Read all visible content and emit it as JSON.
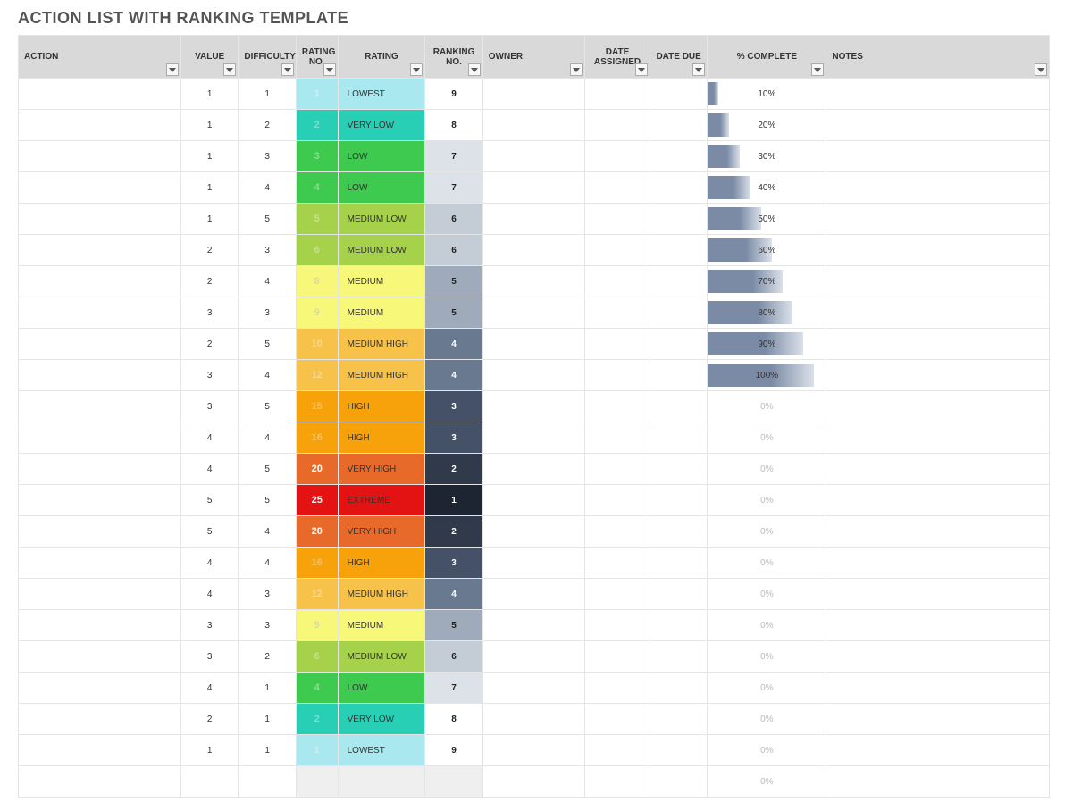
{
  "page": {
    "title": "ACTION LIST WITH RANKING TEMPLATE"
  },
  "headers": {
    "action": "ACTION",
    "value": "VALUE",
    "difficulty": "DIFFICULTY",
    "rating_no": "RATING NO.",
    "rating": "RATING",
    "ranking_no": "RANKING NO.",
    "owner": "OWNER",
    "date_assigned": "DATE ASSIGNED",
    "date_due": "DATE DUE",
    "pct_complete": "% COMPLETE",
    "notes": "NOTES"
  },
  "rows": [
    {
      "action": "",
      "value": 1,
      "difficulty": 1,
      "rating_no": 1,
      "rating": "LOWEST",
      "rating_key": "lowest",
      "ranking_no": 9,
      "pct": 10
    },
    {
      "action": "",
      "value": 1,
      "difficulty": 2,
      "rating_no": 2,
      "rating": "VERY LOW",
      "rating_key": "verylow",
      "ranking_no": 8,
      "pct": 20
    },
    {
      "action": "",
      "value": 1,
      "difficulty": 3,
      "rating_no": 3,
      "rating": "LOW",
      "rating_key": "low",
      "ranking_no": 7,
      "pct": 30
    },
    {
      "action": "",
      "value": 1,
      "difficulty": 4,
      "rating_no": 4,
      "rating": "LOW",
      "rating_key": "low",
      "ranking_no": 7,
      "pct": 40
    },
    {
      "action": "",
      "value": 1,
      "difficulty": 5,
      "rating_no": 5,
      "rating": "MEDIUM LOW",
      "rating_key": "medlow",
      "ranking_no": 6,
      "pct": 50
    },
    {
      "action": "",
      "value": 2,
      "difficulty": 3,
      "rating_no": 6,
      "rating": "MEDIUM LOW",
      "rating_key": "medlow",
      "ranking_no": 6,
      "pct": 60
    },
    {
      "action": "",
      "value": 2,
      "difficulty": 4,
      "rating_no": 8,
      "rating": "MEDIUM",
      "rating_key": "medium",
      "ranking_no": 5,
      "pct": 70
    },
    {
      "action": "",
      "value": 3,
      "difficulty": 3,
      "rating_no": 9,
      "rating": "MEDIUM",
      "rating_key": "medium",
      "ranking_no": 5,
      "pct": 80
    },
    {
      "action": "",
      "value": 2,
      "difficulty": 5,
      "rating_no": 10,
      "rating": "MEDIUM HIGH",
      "rating_key": "medhigh",
      "ranking_no": 4,
      "pct": 90
    },
    {
      "action": "",
      "value": 3,
      "difficulty": 4,
      "rating_no": 12,
      "rating": "MEDIUM HIGH",
      "rating_key": "medhigh",
      "ranking_no": 4,
      "pct": 100
    },
    {
      "action": "",
      "value": 3,
      "difficulty": 5,
      "rating_no": 15,
      "rating": "HIGH",
      "rating_key": "high",
      "ranking_no": 3,
      "pct": 0
    },
    {
      "action": "",
      "value": 4,
      "difficulty": 4,
      "rating_no": 16,
      "rating": "HIGH",
      "rating_key": "high",
      "ranking_no": 3,
      "pct": 0
    },
    {
      "action": "",
      "value": 4,
      "difficulty": 5,
      "rating_no": 20,
      "rating": "VERY HIGH",
      "rating_key": "veryhigh",
      "ranking_no": 2,
      "pct": 0
    },
    {
      "action": "",
      "value": 5,
      "difficulty": 5,
      "rating_no": 25,
      "rating": "EXTREME",
      "rating_key": "extreme",
      "ranking_no": 1,
      "pct": 0
    },
    {
      "action": "",
      "value": 5,
      "difficulty": 4,
      "rating_no": 20,
      "rating": "VERY HIGH",
      "rating_key": "veryhigh",
      "ranking_no": 2,
      "pct": 0
    },
    {
      "action": "",
      "value": 4,
      "difficulty": 4,
      "rating_no": 16,
      "rating": "HIGH",
      "rating_key": "high",
      "ranking_no": 3,
      "pct": 0
    },
    {
      "action": "",
      "value": 4,
      "difficulty": 3,
      "rating_no": 12,
      "rating": "MEDIUM HIGH",
      "rating_key": "medhigh",
      "ranking_no": 4,
      "pct": 0
    },
    {
      "action": "",
      "value": 3,
      "difficulty": 3,
      "rating_no": 9,
      "rating": "MEDIUM",
      "rating_key": "medium",
      "ranking_no": 5,
      "pct": 0
    },
    {
      "action": "",
      "value": 3,
      "difficulty": 2,
      "rating_no": 6,
      "rating": "MEDIUM LOW",
      "rating_key": "medlow",
      "ranking_no": 6,
      "pct": 0
    },
    {
      "action": "",
      "value": 4,
      "difficulty": 1,
      "rating_no": 4,
      "rating": "LOW",
      "rating_key": "low",
      "ranking_no": 7,
      "pct": 0
    },
    {
      "action": "",
      "value": 2,
      "difficulty": 1,
      "rating_no": 2,
      "rating": "VERY LOW",
      "rating_key": "verylow",
      "ranking_no": 8,
      "pct": 0
    },
    {
      "action": "",
      "value": 1,
      "difficulty": 1,
      "rating_no": 1,
      "rating": "LOWEST",
      "rating_key": "lowest",
      "ranking_no": 9,
      "pct": 0
    },
    {
      "action": "",
      "value": "",
      "difficulty": "",
      "rating_no": "",
      "rating": "",
      "rating_key": "blank",
      "ranking_no": "",
      "pct": 0
    }
  ]
}
